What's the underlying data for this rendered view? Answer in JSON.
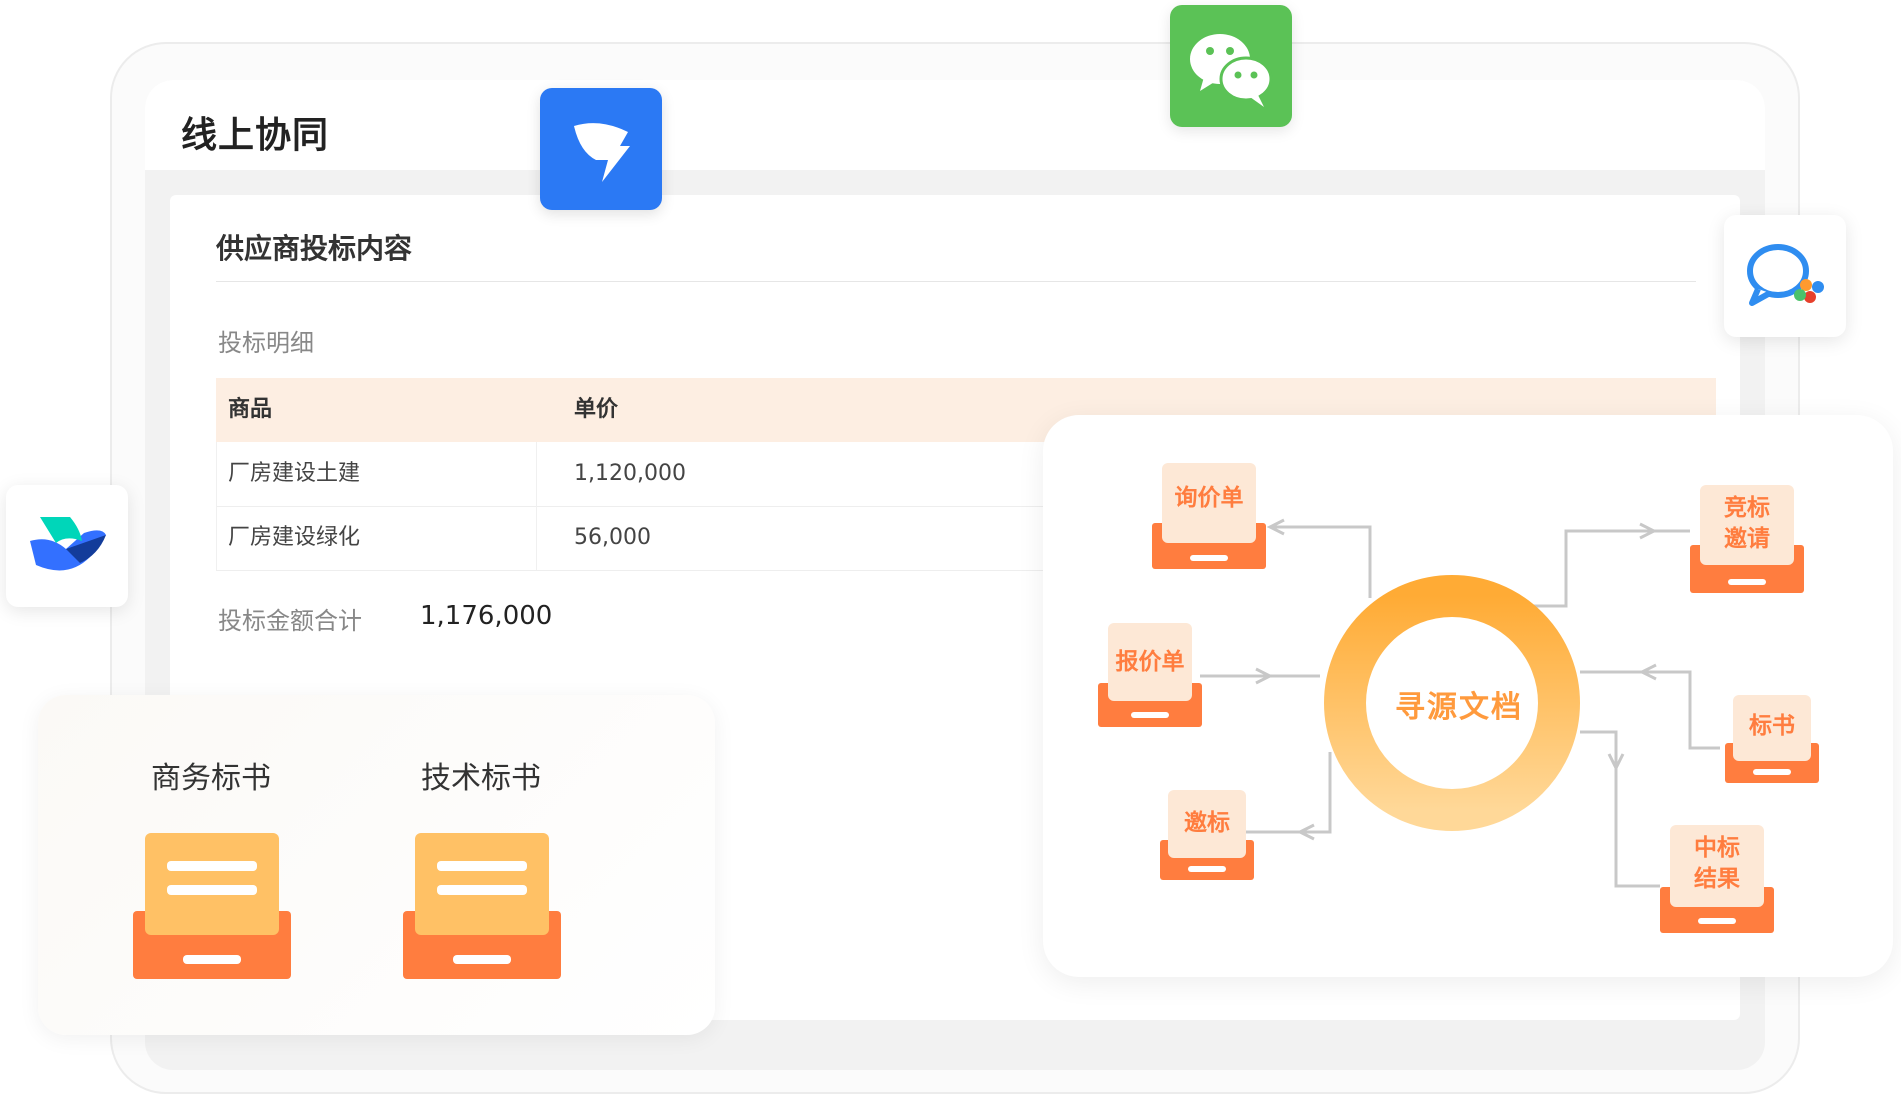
{
  "page": {
    "title": "线上协同"
  },
  "bid_content": {
    "section_title": "供应商投标内容",
    "subsection_title": "投标明细",
    "table": {
      "headers": [
        "商品",
        "单价"
      ],
      "rows": [
        [
          "厂房建设土建",
          "1,120,000"
        ],
        [
          "厂房建设绿化",
          "56,000"
        ]
      ]
    },
    "total_label": "投标金额合计",
    "total_value": "1,176,000"
  },
  "bid_docs": {
    "items": [
      "商务标书",
      "技术标书"
    ]
  },
  "flow": {
    "center_label": "寻源文档",
    "nodes": {
      "inquiry": "询价单",
      "quote": "报价单",
      "invite": "邀标",
      "competitive_invite": "竞标\n邀请",
      "bid_doc": "标书",
      "award_result": "中标\n结果"
    }
  },
  "apps": [
    "dingtalk-icon",
    "wechat-icon",
    "wecom-icon",
    "feishu-icon"
  ],
  "colors": {
    "accent_orange": "#ff7d3f",
    "paper_yellow": "#ffc165",
    "table_header_bg": "#fdeee2",
    "ring_gradient_start": "#ffb43c",
    "ring_gradient_end": "#ffd591",
    "dingtalk_blue": "#2b79f4",
    "wechat_green": "#5bc256"
  }
}
